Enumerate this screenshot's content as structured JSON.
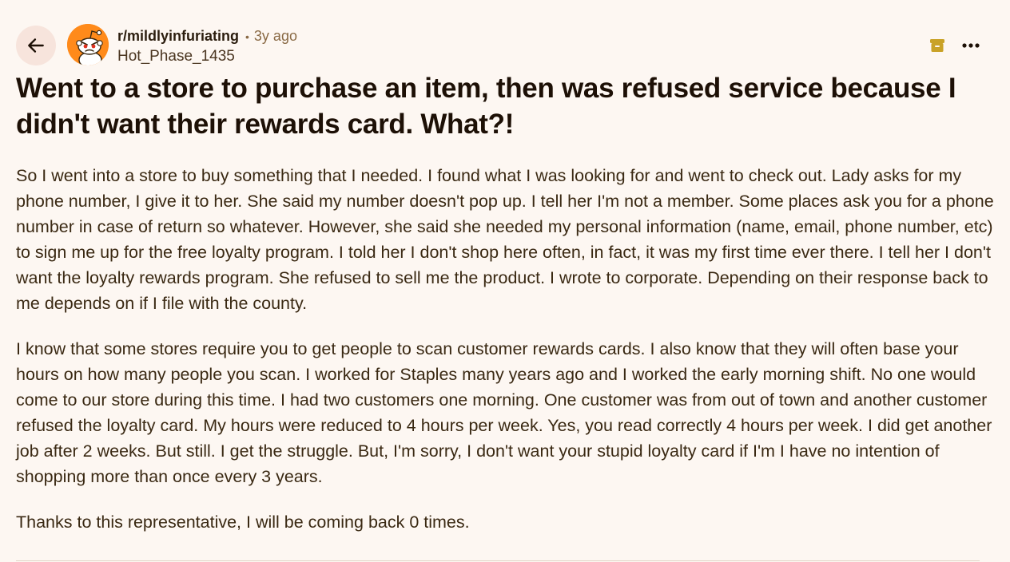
{
  "header": {
    "subreddit": "r/mildlyinfuriating",
    "separator": "•",
    "age": "3y ago",
    "author": "Hot_Phase_1435",
    "icons": {
      "back": "arrow-left-icon",
      "avatar": "reddit-snoo-avatar",
      "archive": "archive-icon",
      "more": "ellipsis-icon"
    }
  },
  "post": {
    "title": "Went to a store to purchase an item, then was refused service because I didn't want their rewards card. What?!",
    "paragraphs": [
      "So I went into a store to buy something that I needed. I found what I was looking for and went to check out. Lady asks for my phone number, I give it to her. She said my number doesn't pop up. I tell her I'm not a member. Some places ask you for a phone number in case of return so whatever. However, she said she needed my personal information (name, email, phone number, etc) to sign me up for the free loyalty program. I told her I don't shop here often, in fact, it was my first time ever there. I tell her I don't want the loyalty rewards program. She refused to sell me the product. I wrote to corporate. Depending on their response back to me depends on if I file with the county.",
      "I know that some stores require you to get people to scan customer rewards cards. I also know that they will often base your hours on how many people you scan. I worked for Staples many years ago and I worked the early morning shift. No one would come to our store during this time. I had two customers one morning. One customer was from out of town and another customer refused the loyalty card. My hours were reduced to 4 hours per week. Yes, you read correctly 4 hours per week. I did get another job after 2 weeks. But still. I get the struggle. But, I'm sorry, I don't want your stupid loyalty card if I'm I have no intention of shopping more than once every 3 years.",
      "Thanks to this representative, I will be coming back 0 times."
    ]
  },
  "colors": {
    "background": "#fdf7f2",
    "text": "#2b1d0e",
    "archive": "#c9a227",
    "avatar": "#ff8a1a"
  }
}
